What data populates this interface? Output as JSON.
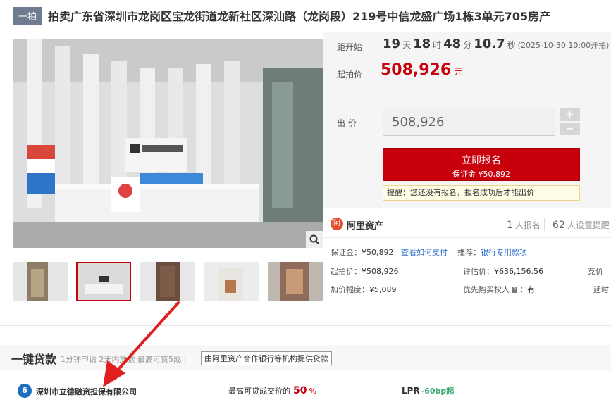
{
  "header": {
    "badge": "一拍",
    "title": "拍卖广东省深圳市龙岗区宝龙街道龙新社区深汕路（龙岗段）219号中信龙盛广场1栋3单元705房产"
  },
  "gallery": {
    "zoom_icon": "magnifier-icon",
    "thumbnail_count": 5,
    "active_thumbnail": 2
  },
  "countdown": {
    "label": "距开始",
    "days": "19",
    "days_unit": "天",
    "hours": "18",
    "hours_unit": "时",
    "minutes": "48",
    "minutes_unit": "分",
    "seconds": "10.7",
    "seconds_unit": "秒",
    "start_time": "(2025-10-30 10:00开拍)"
  },
  "start_price": {
    "label": "起拍价",
    "value": "508,926",
    "unit": "元"
  },
  "bid": {
    "label": "出 价",
    "value": "508,926",
    "plus": "+",
    "minus": "−"
  },
  "signup": {
    "title": "立即报名",
    "deposit": "保证金 ¥50,892",
    "tip": "提醒：您还没有报名，报名成功后才能出价"
  },
  "platform": {
    "logo": "阿",
    "name": "阿里资产",
    "signup_count": "1",
    "signup_label": "人报名",
    "reminder_count": "62",
    "reminder_label": "人设置提醒"
  },
  "details": {
    "deposit_label": "保证金：",
    "deposit_value": "¥50,892",
    "how_to_pay": "查看如何支付",
    "recommend_label": "推荐：",
    "bank_loan": "银行专用款项",
    "start_label": "起拍价：",
    "start_value": "¥508,926",
    "appraisal_label": "评估价：",
    "appraisal_value": "¥636,156.56",
    "bid_cut_label": "竞价",
    "increment_label": "加价幅度：",
    "increment_value": "¥5,089",
    "priority_label": "优先购买权人",
    "priority_tag": "?",
    "priority_value": "：有",
    "extend_label": "延时"
  },
  "loan": {
    "title": "一键贷款",
    "subtitle": "1分钟申请 2天内放款 最高可贷5成 |",
    "tag": "由阿里资产合作银行等机构提供贷款",
    "company_logo": "6",
    "company": "深圳市立德融资担保有限公司",
    "ratio_label": "最高可贷成交价的",
    "ratio_value": "50",
    "ratio_unit": "%",
    "lpr_label": "LPR",
    "lpr_value": "-60bp起"
  },
  "colors": {
    "accent": "#c7000b",
    "badge": "#6f7b8f",
    "link": "#2d6fcb",
    "annotation_arrow": "#e02020"
  }
}
